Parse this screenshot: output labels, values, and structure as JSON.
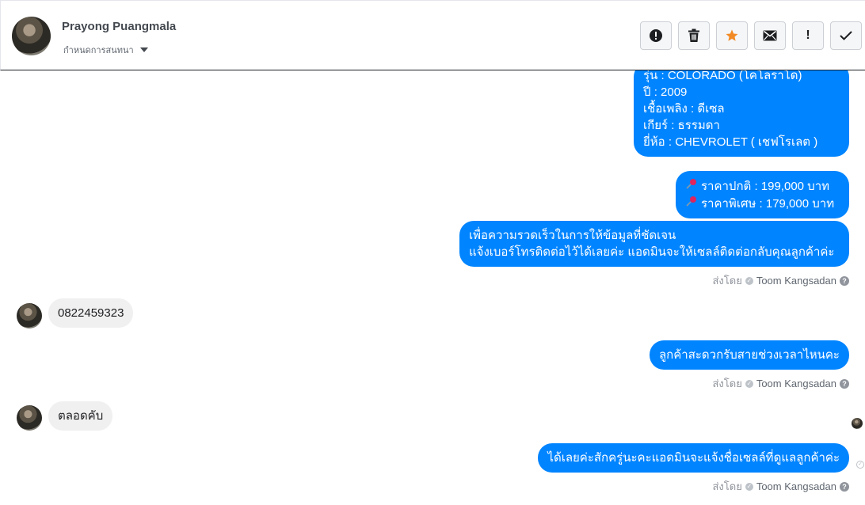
{
  "header": {
    "contact_name": "Prayong Puangmala",
    "assign_label": "กำหนดการสนทนา",
    "actions": [
      {
        "icon": "alert-icon"
      },
      {
        "icon": "trash-icon"
      },
      {
        "icon": "star-icon",
        "color": "#f28b26"
      },
      {
        "icon": "envelope-icon"
      },
      {
        "icon": "exclamation-icon",
        "label": "!"
      },
      {
        "icon": "checkmark-icon"
      }
    ]
  },
  "messages": {
    "car_details": [
      "รุ่น : COLORADO (โคโลราโด)",
      "ปี : 2009",
      "เชื้อเพลิง : ดีเซล",
      "เกียร์ : ธรรมดา",
      "ยี่ห้อ : CHEVROLET ( เชฟโรเลต )"
    ],
    "price_lines": [
      "ราคาปกติ : 199,000 บาท",
      "ราคาพิเศษ : 179,000 บาท"
    ],
    "contact_request": [
      "เพื่อความรวดเร็วในการให้ข้อมูลที่ชัดเจน",
      "แจ้งเบอร์โทรติดต่อไว้ได้เลยค่ะ แอดมินจะให้เซลล์ติดต่อกลับคุณลูกค้าค่ะ"
    ],
    "customer_phone": "0822459323",
    "time_question": "ลูกค้าสะดวกรับสายช่วงเวลาไหนคะ",
    "customer_reply": "ตลอดคับ",
    "final_reply": "ได้เลยค่ะสักครู่นะคะแอดมินจะแจ้งชื่อเซลล์ที่ดูแลลูกค้าค่ะ"
  },
  "sent_by": {
    "prefix": "ส่งโดย",
    "agent": "Toom Kangsadan",
    "help": "?"
  },
  "colors": {
    "outgoing_bubble": "#0084ff",
    "incoming_bubble": "#f1f0f0"
  }
}
